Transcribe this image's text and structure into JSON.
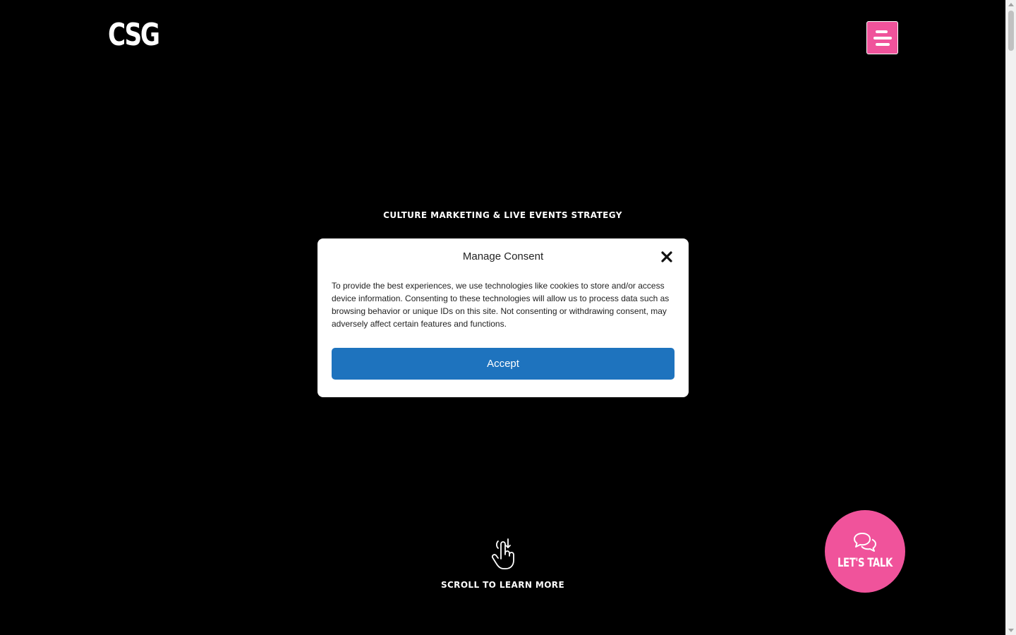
{
  "header": {
    "logo_text": "CSG",
    "menu_icon": "hamburger-icon"
  },
  "hero": {
    "tagline": "CULTURE MARKETING & LIVE EVENTS STRATEGY",
    "scroll_icon": "hand-scroll-down-icon",
    "scroll_text": "SCROLL TO LEARN MORE"
  },
  "floating": {
    "talk_icon": "chat-bubbles-icon",
    "talk_label": "LET'S TALK"
  },
  "consent": {
    "title": "Manage Consent",
    "close_icon": "close-icon",
    "body": "To provide the best experiences, we use technologies like cookies to store and/or access device information. Consenting to these technologies will allow us to process data such as browsing behavior or unique IDs on this site. Not consenting or withdrawing consent, may adversely affect certain features and functions.",
    "accept_label": "Accept"
  },
  "colors": {
    "background": "#000000",
    "accent_pink": "#f0539b",
    "accept_blue": "#1e73be"
  }
}
